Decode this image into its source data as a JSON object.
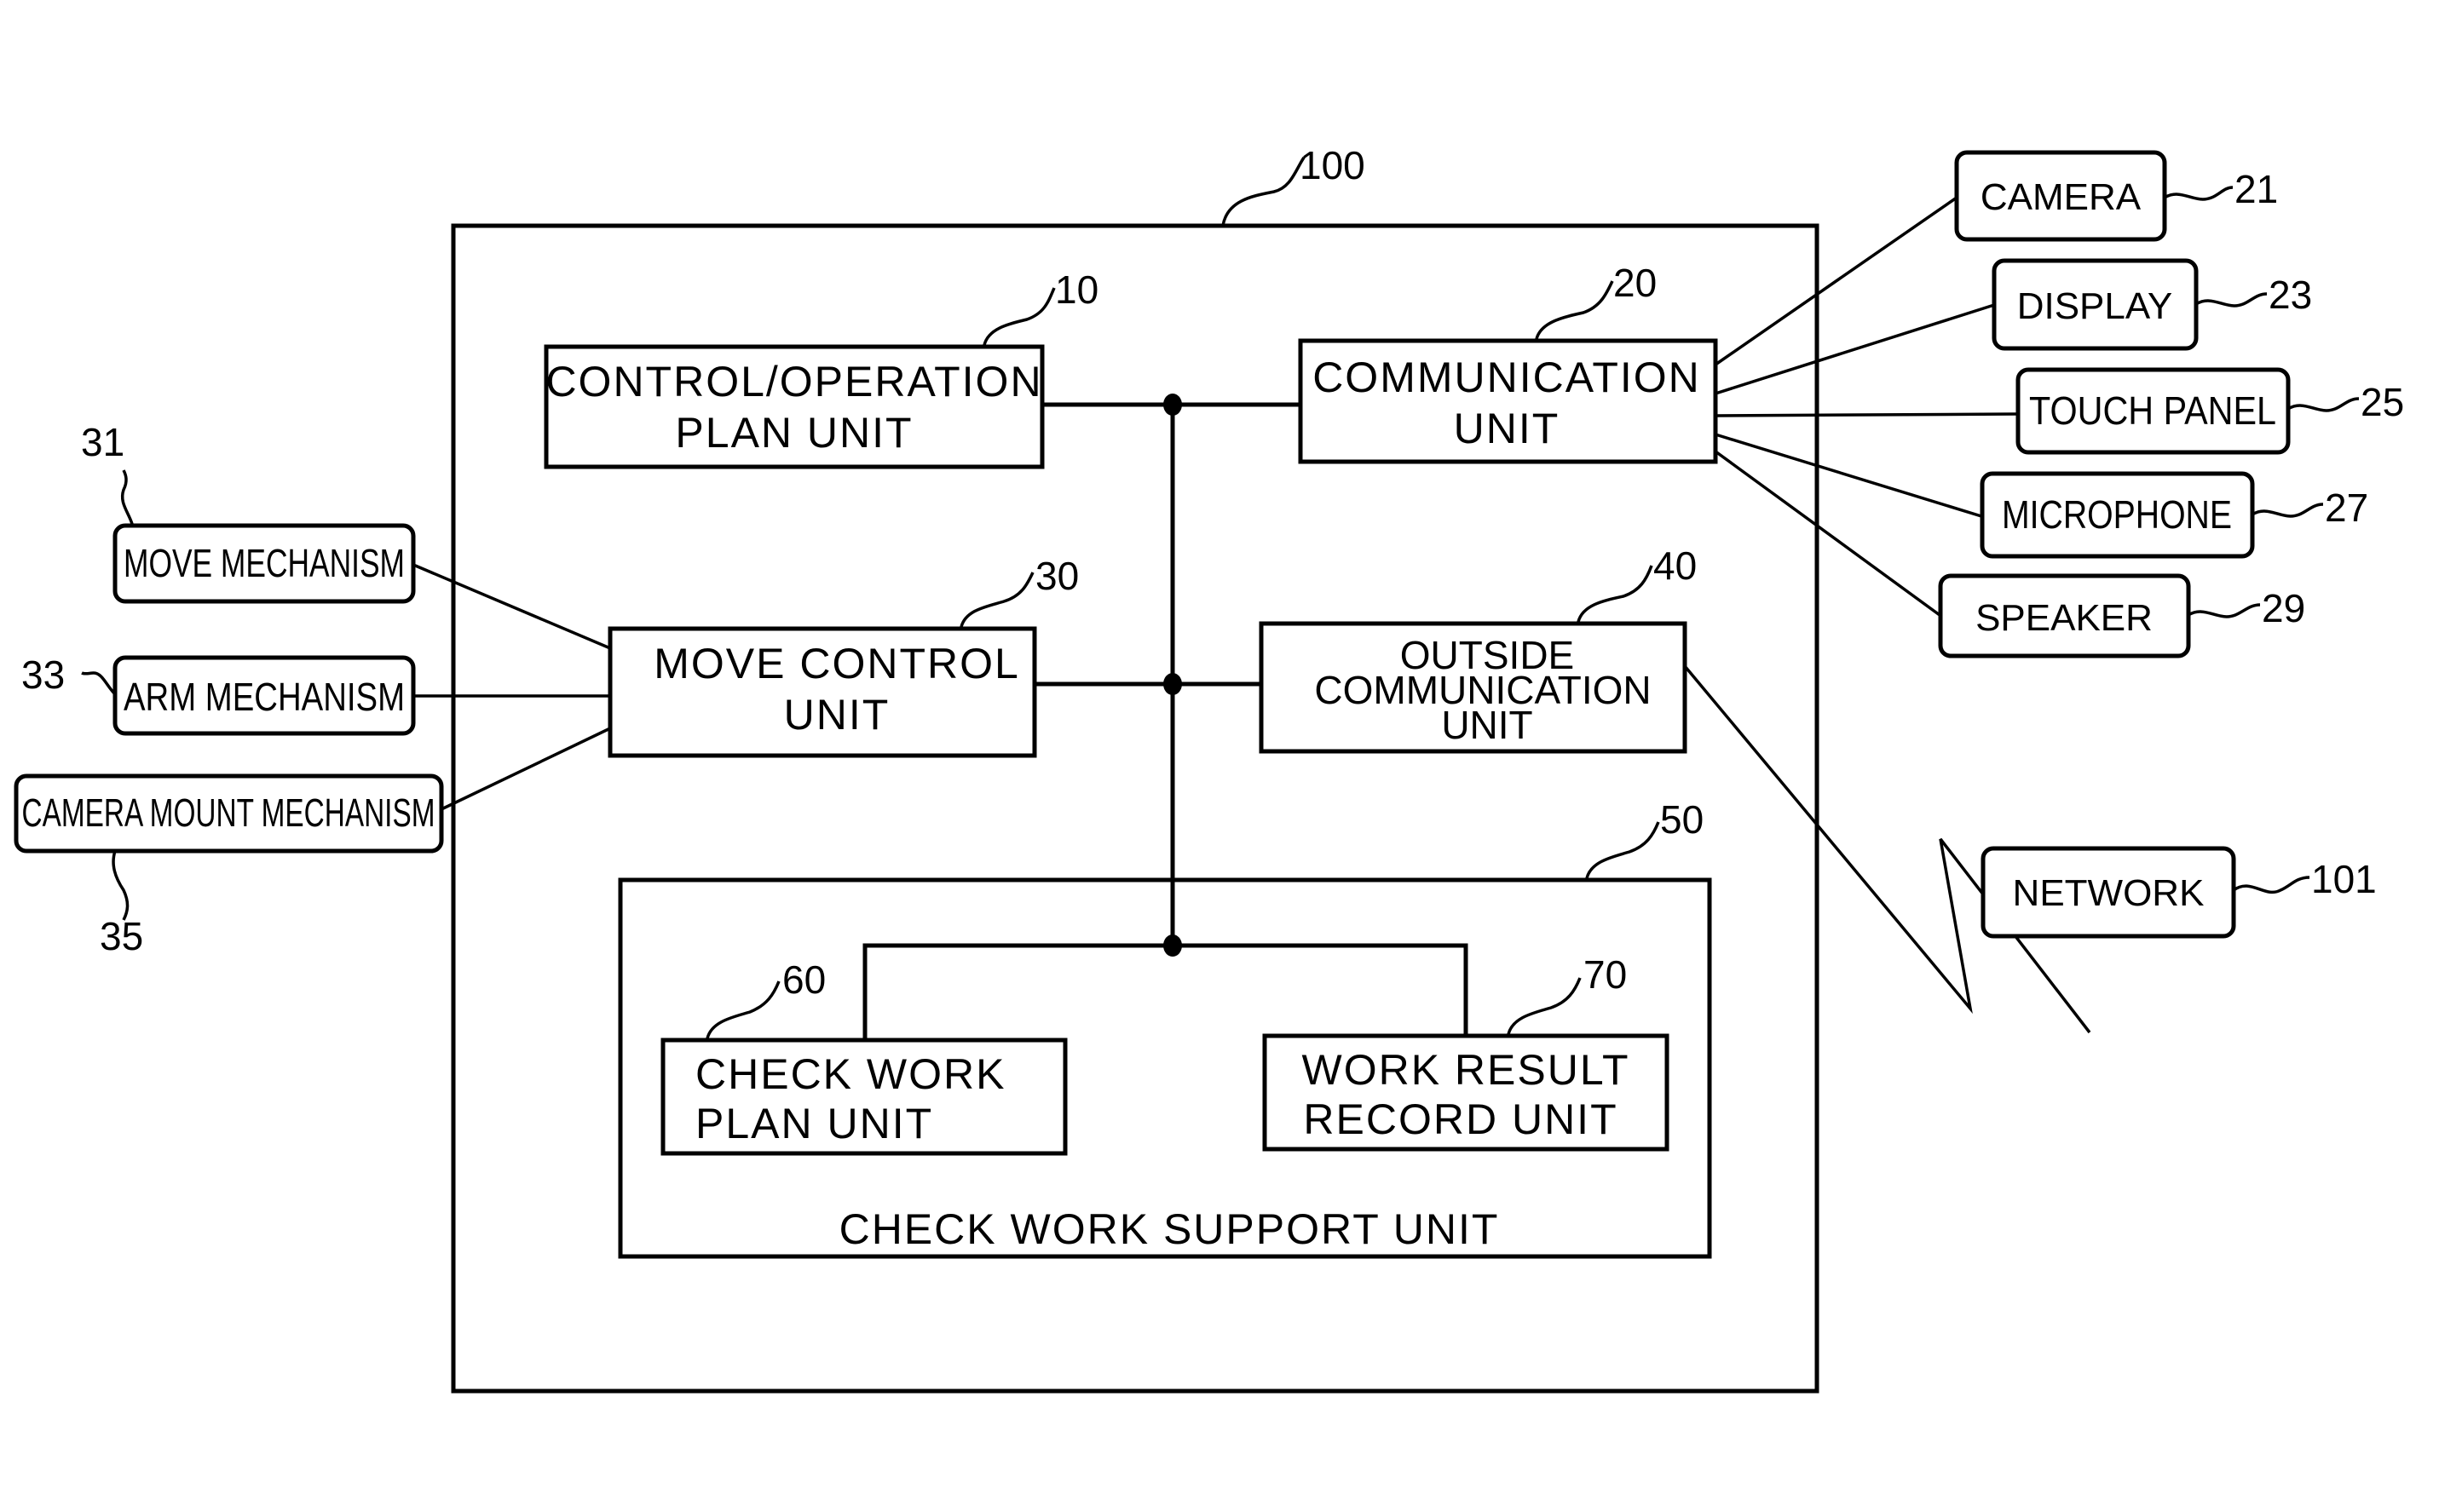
{
  "figure": {
    "main_unit": {
      "ref": "100"
    },
    "blocks": {
      "control_operation_plan": {
        "ref": "10",
        "lines": [
          "CONTROL/OPERATION",
          "PLAN  UNIT"
        ]
      },
      "communication": {
        "ref": "20",
        "lines": [
          "COMMUNICATION",
          "UNIT"
        ]
      },
      "move_control": {
        "ref": "30",
        "lines": [
          "MOVE  CONTROL",
          "UNIT"
        ]
      },
      "outside_communication": {
        "ref": "40",
        "lines": [
          "OUTSIDE",
          "COMMUNICATION",
          "UNIT"
        ]
      },
      "check_work_support": {
        "ref": "50",
        "label": "CHECK  WORK  SUPPORT  UNIT"
      },
      "check_work_plan": {
        "ref": "60",
        "lines": [
          "CHECK  WORK",
          "PLAN  UNIT"
        ]
      },
      "work_result_record": {
        "ref": "70",
        "lines": [
          "WORK  RESULT",
          "RECORD  UNIT"
        ]
      }
    },
    "peripherals": {
      "camera": {
        "ref": "21",
        "label": "CAMERA"
      },
      "display": {
        "ref": "23",
        "label": "DISPLAY"
      },
      "touch_panel": {
        "ref": "25",
        "label": "TOUCH  PANEL"
      },
      "microphone": {
        "ref": "27",
        "label": "MICROPHONE"
      },
      "speaker": {
        "ref": "29",
        "label": "SPEAKER"
      },
      "network": {
        "ref": "101",
        "label": "NETWORK"
      }
    },
    "mechanisms": {
      "move": {
        "ref": "31",
        "label": "MOVE MECHANISM"
      },
      "arm": {
        "ref": "33",
        "label": "ARM MECHANISM"
      },
      "camera_mount": {
        "ref": "35",
        "label": "CAMERA MOUNT MECHANISM"
      }
    }
  }
}
